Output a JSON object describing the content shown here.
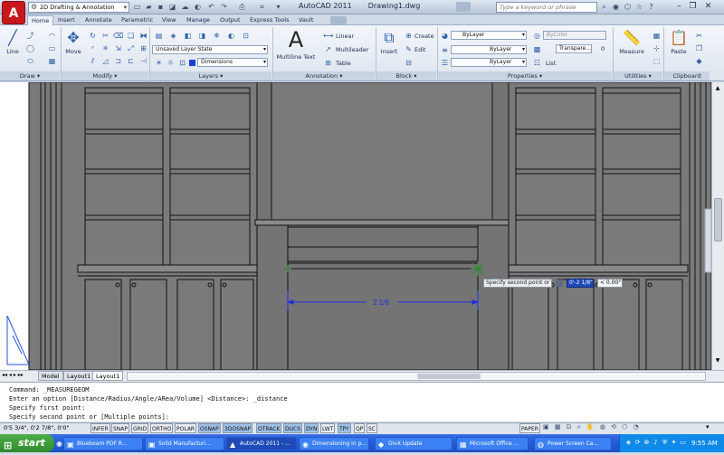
{
  "app": {
    "logo_letter": "A",
    "workspace": "2D Drafting & Annotation",
    "title_app": "AutoCAD 2011",
    "title_doc": "Drawing1.dwg",
    "search_placeholder": "Type a keyword or phrase"
  },
  "tabs": [
    "Home",
    "Insert",
    "Annotate",
    "Parametric",
    "View",
    "Manage",
    "Output",
    "Express Tools",
    "Vault"
  ],
  "active_tab": "Home",
  "ribbon": {
    "draw": {
      "title": "Draw",
      "line_label": "Line"
    },
    "modify": {
      "title": "Modify",
      "move_label": "Move"
    },
    "layers": {
      "title": "Layers",
      "layer_state": "Unsaved Layer State",
      "current_layer": "Dimensions"
    },
    "annotation": {
      "title": "Annotation",
      "mtext_label": "Multiline Text",
      "linear_label": "Linear",
      "multileader_label": "Multileader",
      "table_label": "Table"
    },
    "block": {
      "title": "Block",
      "insert_label": "Insert",
      "create_label": "Create",
      "edit_label": "Edit"
    },
    "properties": {
      "title": "Properties",
      "color": "ByLayer",
      "linetype": "ByLayer",
      "lineweight": "ByLayer",
      "plotstyle": "ByColor",
      "transparency_label": "Transpare...",
      "transparency_value": "0",
      "list_label": "List"
    },
    "utilities": {
      "title": "Utilities",
      "measure_label": "Measure"
    },
    "clipboard": {
      "title": "Clipboard",
      "paste_label": "Paste"
    }
  },
  "drawing": {
    "dimension_text": "2 1/8",
    "tooltip_prompt": "Specify second point or",
    "tooltip_value": "0'-2 1/8\"",
    "tooltip_angle": "< 0.00°"
  },
  "layout_tabs": [
    "Model",
    "Layout1",
    "Layout1"
  ],
  "active_layout": "Layout1",
  "command_history": [
    "Command: _MEASUREGEOM",
    "Enter an option [Distance/Radius/Angle/ARea/Volume] <Distance>: _distance",
    "Specify first point:",
    "Specify second point or [Multiple points]:"
  ],
  "status": {
    "coordinates": "0'5 3/4\",  0'2 7/8\",  0'0\"",
    "toggles": [
      "INFER",
      "SNAP",
      "GRID",
      "ORTHO",
      "POLAR",
      "OSNAP",
      "3DOSNAP",
      "OTRACK",
      "DUCS",
      "DYN",
      "LWT",
      "TPY",
      "QP",
      "SC"
    ],
    "toggles_on": [
      "OSNAP",
      "3DOSNAP",
      "OTRACK",
      "DUCS",
      "DYN",
      "TPY"
    ],
    "paper_label": "PAPER"
  },
  "taskbar": {
    "start_label": "start",
    "tasks": [
      "Bluebeam PDF R...",
      "Solid Manufacturi...",
      "AutoCAD 2011 - ...",
      "Dimensioning in p...",
      "DivX Update",
      "Microsoft Office ...",
      "Power Screen Ca..."
    ],
    "active_task": "AutoCAD 2011 - ...",
    "clock": "9:55 AM"
  }
}
